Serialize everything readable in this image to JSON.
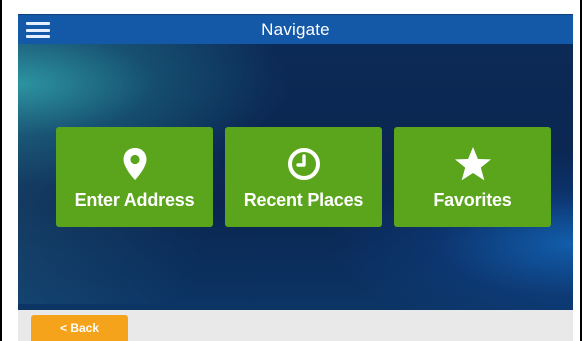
{
  "header": {
    "title": "Navigate",
    "menu_icon": "hamburger-menu-icon",
    "color": "#1458a8"
  },
  "tiles": [
    {
      "label": "Enter Address",
      "icon": "map-pin-icon"
    },
    {
      "label": "Recent Places",
      "icon": "clock-icon"
    },
    {
      "label": "Favorites",
      "icon": "star-icon"
    }
  ],
  "footer": {
    "back_label": "< Back"
  },
  "colors": {
    "tile": "#5aa51b",
    "back_button": "#f5a31a",
    "footer": "#e9e9e9"
  }
}
